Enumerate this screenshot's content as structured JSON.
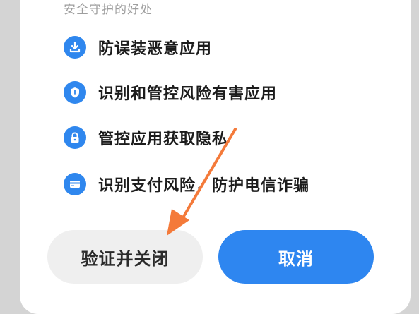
{
  "section": {
    "title": "安全守护的好处"
  },
  "benefits": [
    {
      "label": "防误装恶意应用",
      "icon": "download-icon"
    },
    {
      "label": "识别和管控风险有害应用",
      "icon": "shield-icon"
    },
    {
      "label": "管控应用获取隐私",
      "icon": "lock-icon"
    },
    {
      "label": "识别支付风险，防护电信诈骗",
      "icon": "card-icon"
    }
  ],
  "buttons": {
    "verify_close": "验证并关闭",
    "cancel": "取消"
  },
  "annotation": {
    "arrow_color": "#f47a3a"
  },
  "colors": {
    "accent": "#2e86f0",
    "icon_bg": "#2f87ee",
    "secondary_button_bg": "#efefef"
  }
}
